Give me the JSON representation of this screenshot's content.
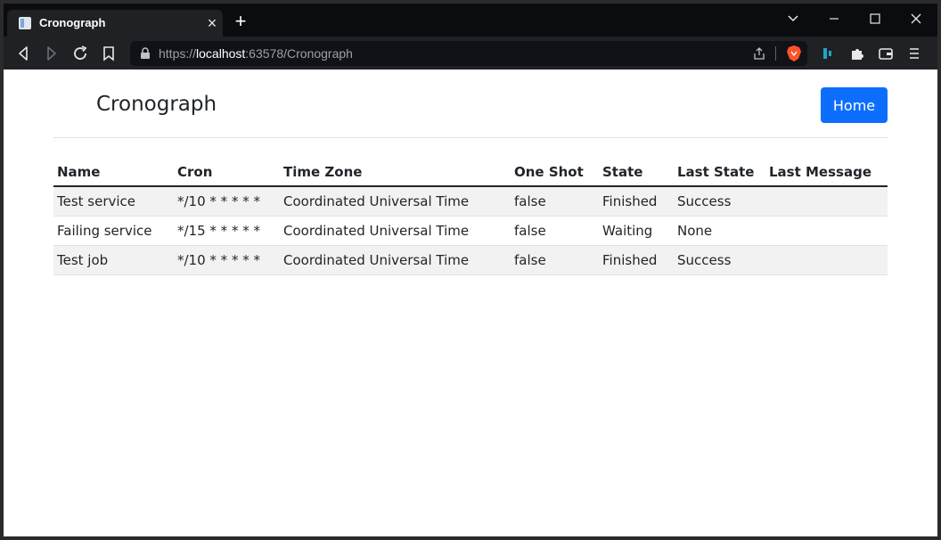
{
  "browser": {
    "tab": {
      "title": "Cronograph",
      "close_glyph": "×"
    },
    "new_tab_glyph": "+",
    "address": {
      "scheme": "https://",
      "host": "localhost",
      "rest": ":63578/Cronograph"
    }
  },
  "page": {
    "brand": "Cronograph",
    "home_button": "Home"
  },
  "table": {
    "columns": [
      "Name",
      "Cron",
      "Time Zone",
      "One Shot",
      "State",
      "Last State",
      "Last Message"
    ],
    "rows": [
      [
        "Test service",
        "*/10 * * * * *",
        "Coordinated Universal Time",
        "false",
        "Finished",
        "Success",
        ""
      ],
      [
        "Failing service",
        "*/15 * * * * *",
        "Coordinated Universal Time",
        "false",
        "Waiting",
        "None",
        ""
      ],
      [
        "Test job",
        "*/10 * * * * *",
        "Coordinated Universal Time",
        "false",
        "Finished",
        "Success",
        ""
      ]
    ]
  },
  "colors": {
    "accent": "#0d6efd",
    "titlebar": "#0b0c10",
    "toolbar": "#202124"
  },
  "icons": [
    "page-favicon-icon",
    "close-icon",
    "plus-icon",
    "chevron-down-icon",
    "minimize-icon",
    "maximize-icon",
    "close-window-icon",
    "back-icon",
    "forward-icon",
    "reload-icon",
    "bookmark-icon",
    "lock-icon",
    "share-icon",
    "brave-lion-icon",
    "extension-icon",
    "puzzle-icon",
    "wallet-icon",
    "menu-icon"
  ]
}
